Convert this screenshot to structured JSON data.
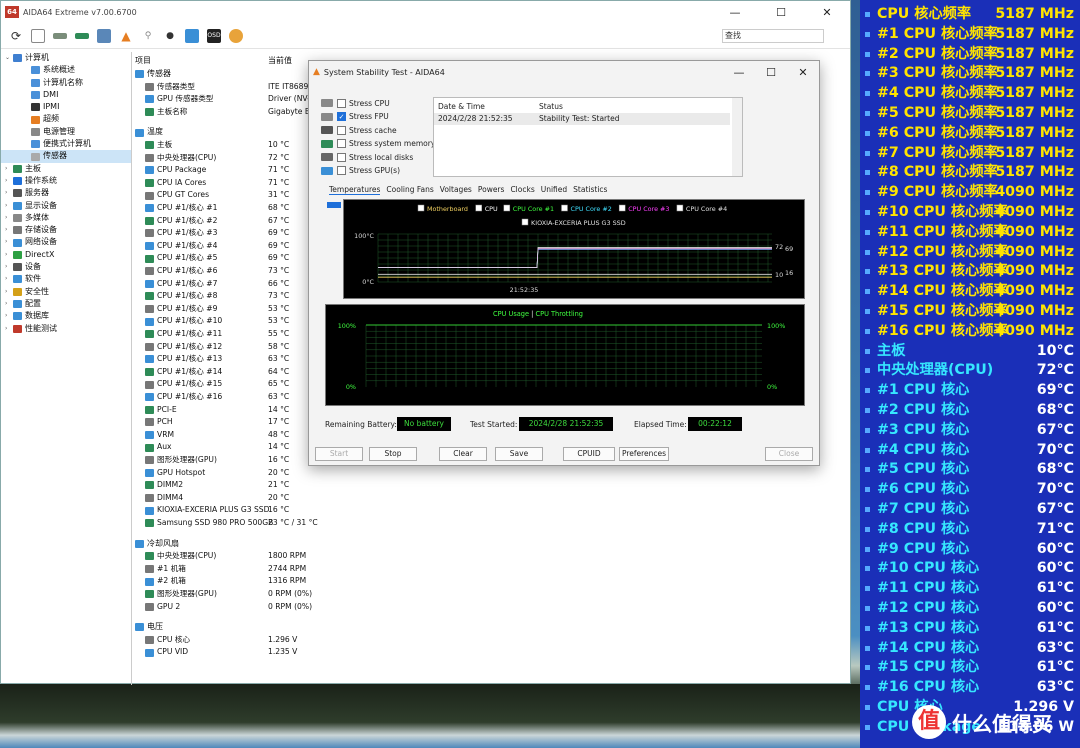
{
  "main_window": {
    "title": "AIDA64 Extreme v7.00.6700",
    "logo": "64",
    "search_placeholder": "查找",
    "tree": [
      {
        "label": "计算机",
        "icon": "computer-icon",
        "indent": 0,
        "exp": "⌄",
        "color": "#3f7fd0"
      },
      {
        "label": "系统概述",
        "icon": "summary-icon",
        "indent": 2,
        "exp": "",
        "color": "#4a90d9"
      },
      {
        "label": "计算机名称",
        "icon": "computer-name-icon",
        "indent": 2,
        "exp": "",
        "color": "#4a90d9"
      },
      {
        "label": "DMI",
        "icon": "dmi-icon",
        "indent": 2,
        "exp": "",
        "color": "#4a90d9"
      },
      {
        "label": "IPMI",
        "icon": "ipmi-icon",
        "indent": 2,
        "exp": "",
        "color": "#333"
      },
      {
        "label": "超频",
        "icon": "overclock-icon",
        "indent": 2,
        "exp": "",
        "color": "#e67e22"
      },
      {
        "label": "电源管理",
        "icon": "power-icon",
        "indent": 2,
        "exp": "",
        "color": "#888"
      },
      {
        "label": "便携式计算机",
        "icon": "laptop-icon",
        "indent": 2,
        "exp": "",
        "color": "#4a90d9"
      },
      {
        "label": "传感器",
        "icon": "sensor-icon",
        "indent": 2,
        "exp": "",
        "color": "#aaa",
        "selected": true
      },
      {
        "label": "主板",
        "icon": "motherboard-icon",
        "indent": 0,
        "exp": "›",
        "color": "#2e8b57"
      },
      {
        "label": "操作系统",
        "icon": "os-icon",
        "indent": 0,
        "exp": "›",
        "color": "#1e6fd9"
      },
      {
        "label": "服务器",
        "icon": "server-icon",
        "indent": 0,
        "exp": "›",
        "color": "#555"
      },
      {
        "label": "显示设备",
        "icon": "display-icon",
        "indent": 0,
        "exp": "›",
        "color": "#3a8fd6"
      },
      {
        "label": "多媒体",
        "icon": "multimedia-icon",
        "indent": 0,
        "exp": "›",
        "color": "#888"
      },
      {
        "label": "存储设备",
        "icon": "storage-icon",
        "indent": 0,
        "exp": "›",
        "color": "#777"
      },
      {
        "label": "网络设备",
        "icon": "network-icon",
        "indent": 0,
        "exp": "›",
        "color": "#3a8fd6"
      },
      {
        "label": "DirectX",
        "icon": "directx-icon",
        "indent": 0,
        "exp": "›",
        "color": "#2ea043"
      },
      {
        "label": "设备",
        "icon": "devices-icon",
        "indent": 0,
        "exp": "›",
        "color": "#555"
      },
      {
        "label": "软件",
        "icon": "software-icon",
        "indent": 0,
        "exp": "›",
        "color": "#3a8fd6"
      },
      {
        "label": "安全性",
        "icon": "security-icon",
        "indent": 0,
        "exp": "›",
        "color": "#d4a017"
      },
      {
        "label": "配置",
        "icon": "config-icon",
        "indent": 0,
        "exp": "›",
        "color": "#3a8fd6"
      },
      {
        "label": "数据库",
        "icon": "database-icon",
        "indent": 0,
        "exp": "›",
        "color": "#3a8fd6"
      },
      {
        "label": "性能测试",
        "icon": "benchmark-icon",
        "indent": 0,
        "exp": "›",
        "color": "#c0392b"
      }
    ],
    "col_item": "项目",
    "col_value": "当前值",
    "rows": [
      {
        "type": "sec",
        "label": "传感器",
        "icon": "sensor-section-icon"
      },
      {
        "label": "传感器类型",
        "value": "ITE IT8689E",
        "icon": "sensor-type-icon"
      },
      {
        "label": "GPU 传感器类型",
        "value": "Driver  (NV-",
        "icon": "gpu-sensor-icon"
      },
      {
        "label": "主板名称",
        "value": "Gigabyte B6",
        "icon": "board-name-icon"
      },
      {
        "type": "gap"
      },
      {
        "type": "sec",
        "label": "温度",
        "icon": "temperature-section-icon"
      },
      {
        "label": "主板",
        "value": "10 °C",
        "icon": "board-temp-icon"
      },
      {
        "label": "中央处理器(CPU)",
        "value": "72 °C",
        "icon": "cpu-temp-icon"
      },
      {
        "label": "CPU Package",
        "value": "71 °C",
        "icon": "cpu-package-icon"
      },
      {
        "label": "CPU IA Cores",
        "value": "71 °C",
        "icon": "cpu-ia-icon"
      },
      {
        "label": "CPU GT Cores",
        "value": "31 °C",
        "icon": "cpu-gt-icon"
      },
      {
        "label": "CPU #1/核心 #1",
        "value": "68 °C",
        "icon": "core-icon"
      },
      {
        "label": "CPU #1/核心 #2",
        "value": "67 °C",
        "icon": "core-icon"
      },
      {
        "label": "CPU #1/核心 #3",
        "value": "69 °C",
        "icon": "core-icon"
      },
      {
        "label": "CPU #1/核心 #4",
        "value": "69 °C",
        "icon": "core-icon"
      },
      {
        "label": "CPU #1/核心 #5",
        "value": "69 °C",
        "icon": "core-icon"
      },
      {
        "label": "CPU #1/核心 #6",
        "value": "73 °C",
        "icon": "core-icon"
      },
      {
        "label": "CPU #1/核心 #7",
        "value": "66 °C",
        "icon": "core-icon"
      },
      {
        "label": "CPU #1/核心 #8",
        "value": "73 °C",
        "icon": "core-icon"
      },
      {
        "label": "CPU #1/核心 #9",
        "value": "53 °C",
        "icon": "core-icon"
      },
      {
        "label": "CPU #1/核心 #10",
        "value": "53 °C",
        "icon": "core-icon"
      },
      {
        "label": "CPU #1/核心 #11",
        "value": "55 °C",
        "icon": "core-icon"
      },
      {
        "label": "CPU #1/核心 #12",
        "value": "58 °C",
        "icon": "core-icon"
      },
      {
        "label": "CPU #1/核心 #13",
        "value": "63 °C",
        "icon": "core-icon"
      },
      {
        "label": "CPU #1/核心 #14",
        "value": "64 °C",
        "icon": "core-icon"
      },
      {
        "label": "CPU #1/核心 #15",
        "value": "65 °C",
        "icon": "core-icon"
      },
      {
        "label": "CPU #1/核心 #16",
        "value": "63 °C",
        "icon": "core-icon"
      },
      {
        "label": "PCI-E",
        "value": "14 °C",
        "icon": "pcie-icon"
      },
      {
        "label": "PCH",
        "value": "17 °C",
        "icon": "pch-icon"
      },
      {
        "label": "VRM",
        "value": "48 °C",
        "icon": "vrm-icon"
      },
      {
        "label": "Aux",
        "value": "14 °C",
        "icon": "aux-icon"
      },
      {
        "label": "图形处理器(GPU)",
        "value": "16 °C",
        "icon": "gpu-icon"
      },
      {
        "label": "GPU Hotspot",
        "value": "20 °C",
        "icon": "gpu-hotspot-icon"
      },
      {
        "label": "DIMM2",
        "value": "21 °C",
        "icon": "dimm-icon"
      },
      {
        "label": "DIMM4",
        "value": "20 °C",
        "icon": "dimm-icon"
      },
      {
        "label": "KIOXIA-EXCERIA PLUS G3 SSD",
        "value": "16 °C",
        "icon": "ssd-icon"
      },
      {
        "label": "Samsung SSD 980 PRO 500GB",
        "value": "23 °C / 31 °C",
        "icon": "ssd-icon"
      },
      {
        "type": "gap"
      },
      {
        "type": "sec",
        "label": "冷却风扇",
        "icon": "fan-section-icon"
      },
      {
        "label": "中央处理器(CPU)",
        "value": "1800 RPM",
        "icon": "fan-icon"
      },
      {
        "label": "#1 机箱",
        "value": "2744 RPM",
        "icon": "fan-icon"
      },
      {
        "label": "#2 机箱",
        "value": "1316 RPM",
        "icon": "fan-icon"
      },
      {
        "label": "图形处理器(GPU)",
        "value": "0 RPM  (0%)",
        "icon": "fan-icon"
      },
      {
        "label": "GPU 2",
        "value": "0 RPM  (0%)",
        "icon": "fan-icon"
      },
      {
        "type": "gap"
      },
      {
        "type": "sec",
        "label": "电压",
        "icon": "voltage-section-icon"
      },
      {
        "label": "CPU 核心",
        "value": "1.296 V",
        "icon": "voltage-icon"
      },
      {
        "label": "CPU VID",
        "value": "1.235 V",
        "icon": "voltage-icon"
      }
    ]
  },
  "sst": {
    "title": "System Stability Test - AIDA64",
    "options": [
      {
        "label": "Stress CPU",
        "checked": false,
        "color": "#888"
      },
      {
        "label": "Stress FPU",
        "checked": true,
        "color": "#888"
      },
      {
        "label": "Stress cache",
        "checked": false,
        "color": "#555"
      },
      {
        "label": "Stress system memory",
        "checked": false,
        "color": "#2e8b57"
      },
      {
        "label": "Stress local disks",
        "checked": false,
        "color": "#666"
      },
      {
        "label": "Stress GPU(s)",
        "checked": false,
        "color": "#3a8fd6"
      }
    ],
    "status_headers": {
      "date": "Date & Time",
      "status": "Status"
    },
    "status_row": {
      "date": "2024/2/28 21:52:35",
      "status": "Stability Test: Started"
    },
    "tabs": [
      "Temperatures",
      "Cooling Fans",
      "Voltages",
      "Powers",
      "Clocks",
      "Unified",
      "Statistics"
    ],
    "temp_legend": [
      {
        "label": "Motherboard",
        "color": "#f0d060"
      },
      {
        "label": "CPU",
        "color": "#ffffff"
      },
      {
        "label": "CPU Core #1",
        "color": "#40ff40"
      },
      {
        "label": "CPU Core #2",
        "color": "#40e0ff"
      },
      {
        "label": "CPU Core #3",
        "color": "#ff40ff"
      },
      {
        "label": "CPU Core #4",
        "color": "#e0e0e0"
      },
      {
        "label": "KIOXIA-EXCERIA PLUS G3 SSD",
        "color": "#e0e0e0"
      }
    ],
    "temp_axis": {
      "top": "100°C",
      "bottom": "0°C",
      "time": "21:52:35",
      "r1": "72",
      "r2": "69",
      "r3": "10",
      "r4": "16"
    },
    "usage_legend": {
      "a": "CPU Usage",
      "sep": "|",
      "b": "CPU Throttling"
    },
    "usage_axis": {
      "top": "100%",
      "bottom": "0%",
      "rtop": "100%",
      "rbottom": "0%"
    },
    "battery_label": "Remaining Battery:",
    "battery_value": "No battery",
    "started_label": "Test Started:",
    "started_value": "2024/2/28 21:52:35",
    "elapsed_label": "Elapsed Time:",
    "elapsed_value": "00:22:12",
    "buttons": {
      "start": "Start",
      "stop": "Stop",
      "clear": "Clear",
      "save": "Save",
      "cpuid": "CPUID",
      "prefs": "Preferences",
      "close": "Close"
    }
  },
  "osd": [
    {
      "k": "CPU 核心频率",
      "v": "5187 MHz",
      "t": "f"
    },
    {
      "k": "#1 CPU 核心频率",
      "v": "5187 MHz",
      "t": "f"
    },
    {
      "k": "#2 CPU 核心频率",
      "v": "5187 MHz",
      "t": "f"
    },
    {
      "k": "#3 CPU 核心频率",
      "v": "5187 MHz",
      "t": "f"
    },
    {
      "k": "#4 CPU 核心频率",
      "v": "5187 MHz",
      "t": "f"
    },
    {
      "k": "#5 CPU 核心频率",
      "v": "5187 MHz",
      "t": "f"
    },
    {
      "k": "#6 CPU 核心频率",
      "v": "5187 MHz",
      "t": "f"
    },
    {
      "k": "#7 CPU 核心频率",
      "v": "5187 MHz",
      "t": "f"
    },
    {
      "k": "#8 CPU 核心频率",
      "v": "5187 MHz",
      "t": "f"
    },
    {
      "k": "#9 CPU 核心频率",
      "v": "4090 MHz",
      "t": "f"
    },
    {
      "k": "#10 CPU 核心频率",
      "v": "4090 MHz",
      "t": "f"
    },
    {
      "k": "#11 CPU 核心频率",
      "v": "4090 MHz",
      "t": "f"
    },
    {
      "k": "#12 CPU 核心频率",
      "v": "4090 MHz",
      "t": "f"
    },
    {
      "k": "#13 CPU 核心频率",
      "v": "4090 MHz",
      "t": "f"
    },
    {
      "k": "#14 CPU 核心频率",
      "v": "4090 MHz",
      "t": "f"
    },
    {
      "k": "#15 CPU 核心频率",
      "v": "4090 MHz",
      "t": "f"
    },
    {
      "k": "#16 CPU 核心频率",
      "v": "4090 MHz",
      "t": "f"
    },
    {
      "k": "主板",
      "v": "10°C",
      "t": "t"
    },
    {
      "k": "中央处理器(CPU)",
      "v": "72°C",
      "t": "t"
    },
    {
      "k": " #1 CPU 核心",
      "v": "69°C",
      "t": "t"
    },
    {
      "k": " #2 CPU 核心",
      "v": "68°C",
      "t": "t"
    },
    {
      "k": " #3 CPU 核心",
      "v": "67°C",
      "t": "t"
    },
    {
      "k": " #4 CPU 核心",
      "v": "70°C",
      "t": "t"
    },
    {
      "k": " #5 CPU 核心",
      "v": "68°C",
      "t": "t"
    },
    {
      "k": " #6 CPU 核心",
      "v": "70°C",
      "t": "t"
    },
    {
      "k": " #7 CPU 核心",
      "v": "67°C",
      "t": "t"
    },
    {
      "k": " #8 CPU 核心",
      "v": "71°C",
      "t": "t"
    },
    {
      "k": " #9 CPU 核心",
      "v": "60°C",
      "t": "t"
    },
    {
      "k": " #10 CPU 核心",
      "v": "60°C",
      "t": "t"
    },
    {
      "k": " #11 CPU 核心",
      "v": "61°C",
      "t": "t"
    },
    {
      "k": " #12 CPU 核心",
      "v": "60°C",
      "t": "t"
    },
    {
      "k": " #13 CPU 核心",
      "v": "61°C",
      "t": "t"
    },
    {
      "k": " #14 CPU 核心",
      "v": "63°C",
      "t": "t"
    },
    {
      "k": " #15 CPU 核心",
      "v": "61°C",
      "t": "t"
    },
    {
      "k": " #16 CPU 核心",
      "v": "63°C",
      "t": "t"
    },
    {
      "k": "CPU 核心",
      "v": "1.296 V",
      "t": "t"
    },
    {
      "k": "CPU Package",
      "v": "113.06 W",
      "t": "t"
    }
  ],
  "watermark": {
    "icon": "值",
    "text": "什么值得买"
  }
}
